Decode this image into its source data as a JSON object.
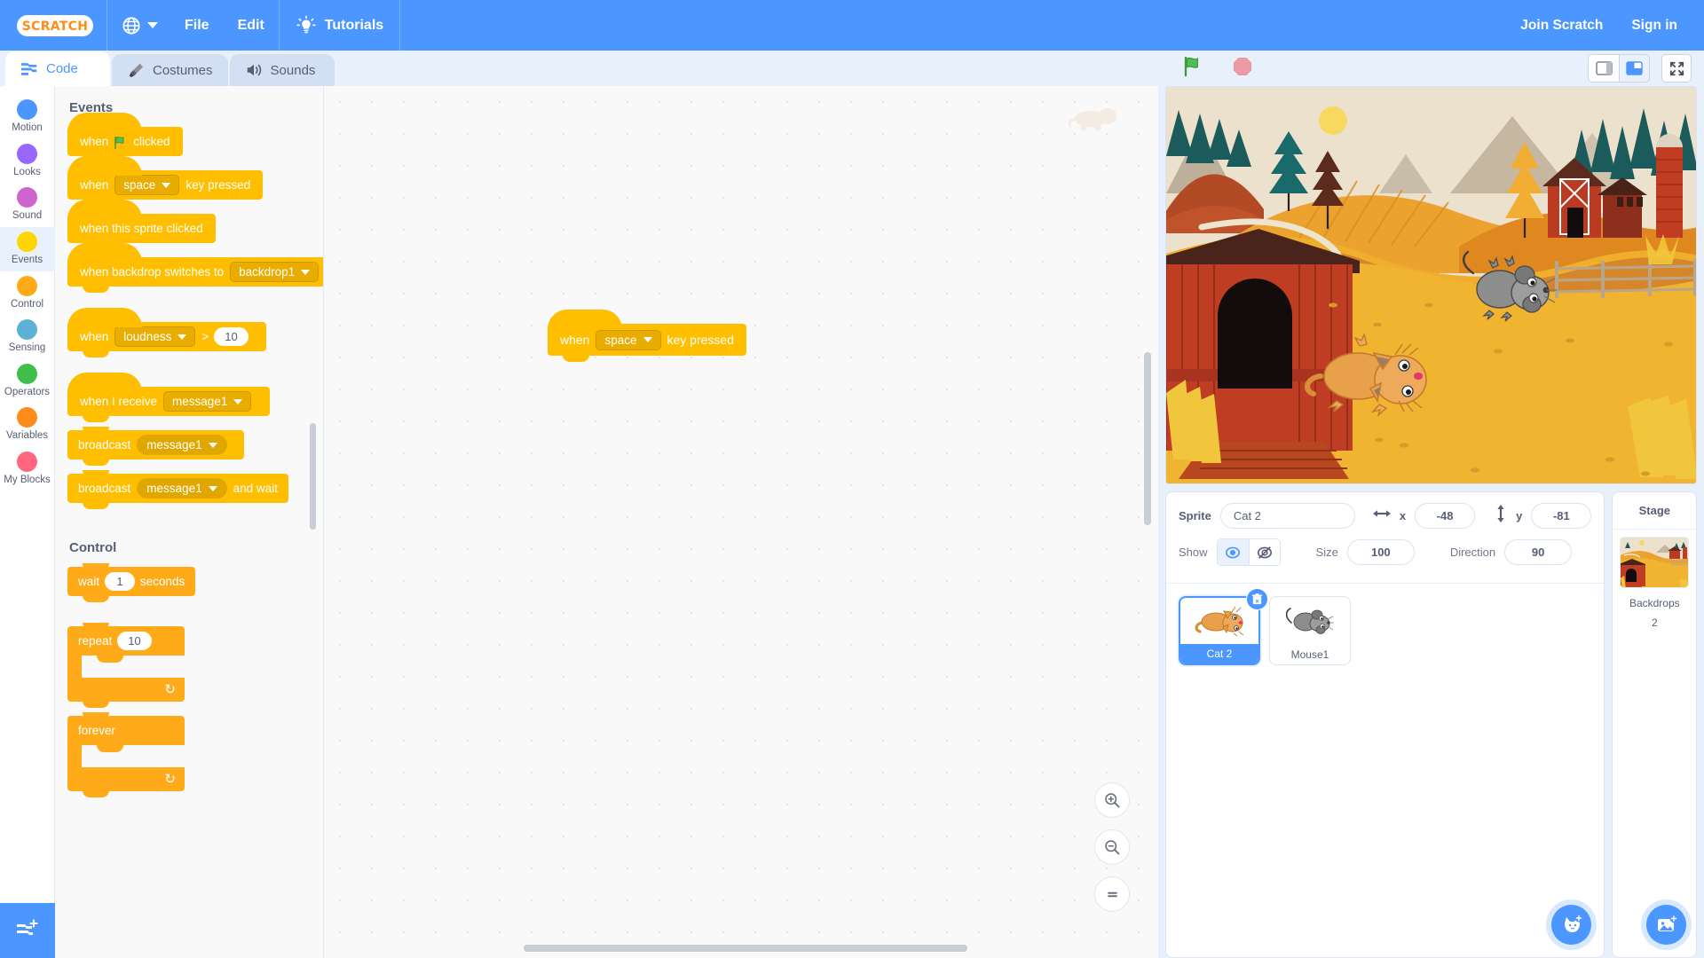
{
  "menubar": {
    "logo_text": "SCRATCH",
    "logo_icon": "scratch-logo",
    "globe_icon": "globe-icon",
    "items": [
      {
        "label": "File"
      },
      {
        "label": "Edit"
      }
    ],
    "tutorials": {
      "label": "Tutorials",
      "icon": "lightbulb-icon"
    },
    "join": "Join Scratch",
    "signin": "Sign in"
  },
  "tabs": [
    {
      "label": "Code",
      "icon": "code-blocks-icon",
      "active": true
    },
    {
      "label": "Costumes",
      "icon": "paintbrush-icon",
      "active": false
    },
    {
      "label": "Sounds",
      "icon": "speaker-icon",
      "active": false
    }
  ],
  "categories": [
    {
      "label": "Motion",
      "color": "#4c97ff",
      "selected": false
    },
    {
      "label": "Looks",
      "color": "#9966ff",
      "selected": false
    },
    {
      "label": "Sound",
      "color": "#cf63cf",
      "selected": false
    },
    {
      "label": "Events",
      "color": "#ffd500",
      "selected": true
    },
    {
      "label": "Control",
      "color": "#ffab19",
      "selected": false
    },
    {
      "label": "Sensing",
      "color": "#5cb1d6",
      "selected": false
    },
    {
      "label": "Operators",
      "color": "#40bf4a",
      "selected": false
    },
    {
      "label": "Variables",
      "color": "#ff8c1a",
      "selected": false
    },
    {
      "label": "My Blocks",
      "color": "#ff6680",
      "selected": false
    }
  ],
  "palette": {
    "section_events": "Events",
    "section_control": "Control",
    "events_blocks": {
      "when_flag_clicked": {
        "pre": "when",
        "post": "clicked",
        "icon": "green-flag-icon"
      },
      "when_key_pressed": {
        "pre": "when",
        "value": "space",
        "post": "key pressed"
      },
      "when_sprite_clicked": {
        "label": "when this sprite clicked"
      },
      "when_backdrop_switches": {
        "pre": "when backdrop switches to",
        "value": "backdrop1"
      },
      "when_loudness": {
        "pre": "when",
        "value": "loudness",
        "op": ">",
        "num": "10"
      },
      "when_i_receive": {
        "pre": "when I receive",
        "value": "message1"
      },
      "broadcast": {
        "pre": "broadcast",
        "value": "message1"
      },
      "broadcast_and_wait": {
        "pre": "broadcast",
        "value": "message1",
        "post": "and wait"
      }
    },
    "control_blocks": {
      "wait": {
        "pre": "wait",
        "num": "1",
        "post": "seconds"
      },
      "repeat": {
        "pre": "repeat",
        "num": "10"
      },
      "forever": {
        "label": "forever"
      }
    }
  },
  "workspace": {
    "script_block": {
      "pre": "when",
      "value": "space",
      "post": "key pressed"
    },
    "zoom_in_icon": "zoom-in-icon",
    "zoom_out_icon": "zoom-out-icon",
    "zoom_reset_icon": "zoom-reset-icon",
    "watermark_icon": "sprite-watermark-cat"
  },
  "stage_controls": {
    "green_flag_icon": "green-flag-icon",
    "stop_icon": "stop-sign-icon",
    "small_stage_icon": "small-stage-icon",
    "large_stage_icon": "large-stage-icon",
    "fullscreen_icon": "fullscreen-icon"
  },
  "sprite_info": {
    "sprite_label": "Sprite",
    "sprite_name": "Cat 2",
    "x_label": "x",
    "x_value": "-48",
    "y_label": "y",
    "y_value": "-81",
    "show_label": "Show",
    "show_on_icon": "eye-visible-icon",
    "show_off_icon": "eye-hidden-icon",
    "size_label": "Size",
    "size_value": "100",
    "direction_label": "Direction",
    "direction_value": "90",
    "width_arrow_icon": "horizontal-arrow-icon",
    "height_arrow_icon": "vertical-arrow-icon"
  },
  "sprites": [
    {
      "name": "Cat 2",
      "selected": true,
      "icon": "cat-sprite-thumb"
    },
    {
      "name": "Mouse1",
      "selected": false,
      "icon": "mouse-sprite-thumb"
    }
  ],
  "sprite_actions": {
    "delete_icon": "trash-delete-icon",
    "add_sprite_icon": "add-sprite-cat-icon",
    "add_backdrop_icon": "add-backdrop-image-icon"
  },
  "stage_panel": {
    "title": "Stage",
    "backdrops_label": "Backdrops",
    "backdrops_count": "2"
  },
  "colors": {
    "brand_blue": "#4c97ff",
    "events_yellow": "#ffbf00",
    "control_orange": "#ffab19",
    "text_gray": "#575e75",
    "panel_bg": "#e8f0fc"
  }
}
